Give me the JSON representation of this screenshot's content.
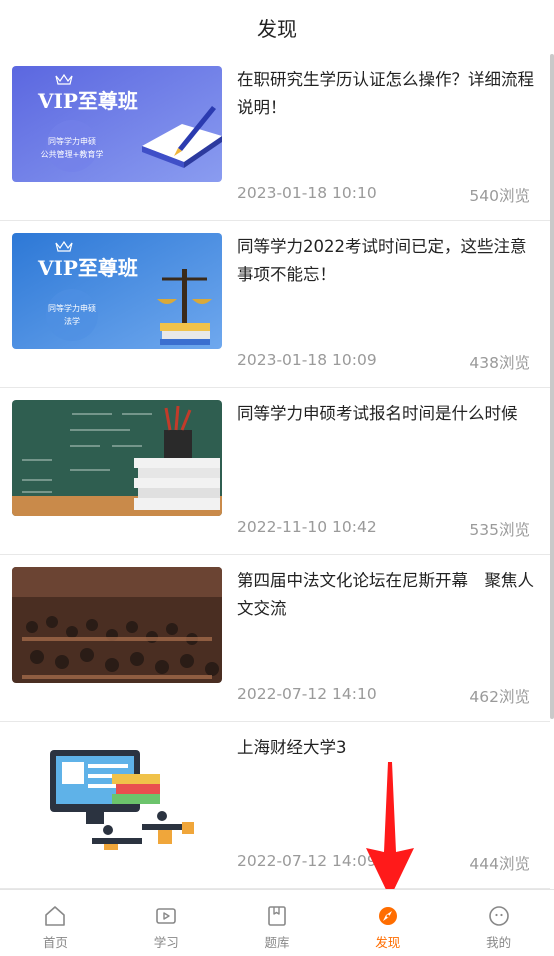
{
  "header": {
    "title": "发现"
  },
  "articles": [
    {
      "title": "在职研究生学历认证怎么操作？详细流程说明！",
      "date": "2023-01-18 10:10",
      "views": "540浏览",
      "thumb": {
        "heading": "VIP至尊班",
        "line1": "同等学力申硕",
        "line2": "公共管理+教育学"
      }
    },
    {
      "title": "同等学力2022考试时间已定，这些注意事项不能忘！",
      "date": "2023-01-18 10:09",
      "views": "438浏览",
      "thumb": {
        "heading": "VIP至尊班",
        "line1": "同等学力申硕",
        "line2": "法学"
      }
    },
    {
      "title": "同等学力申硕考试报名时间是什么时候",
      "date": "2022-11-10 10:42",
      "views": "535浏览"
    },
    {
      "title": "第四届中法文化论坛在尼斯开幕　聚焦人文交流",
      "date": "2022-07-12 14:10",
      "views": "462浏览"
    },
    {
      "title": "上海财经大学3",
      "date": "2022-07-12 14:09",
      "views": "444浏览"
    }
  ],
  "tabbar": {
    "tabs": [
      {
        "label": "首页",
        "icon": "home-icon"
      },
      {
        "label": "学习",
        "icon": "video-icon"
      },
      {
        "label": "题库",
        "icon": "book-icon"
      },
      {
        "label": "发现",
        "icon": "compass-icon",
        "active": true
      },
      {
        "label": "我的",
        "icon": "user-face-icon"
      }
    ],
    "active_color": "#ff6d00"
  }
}
